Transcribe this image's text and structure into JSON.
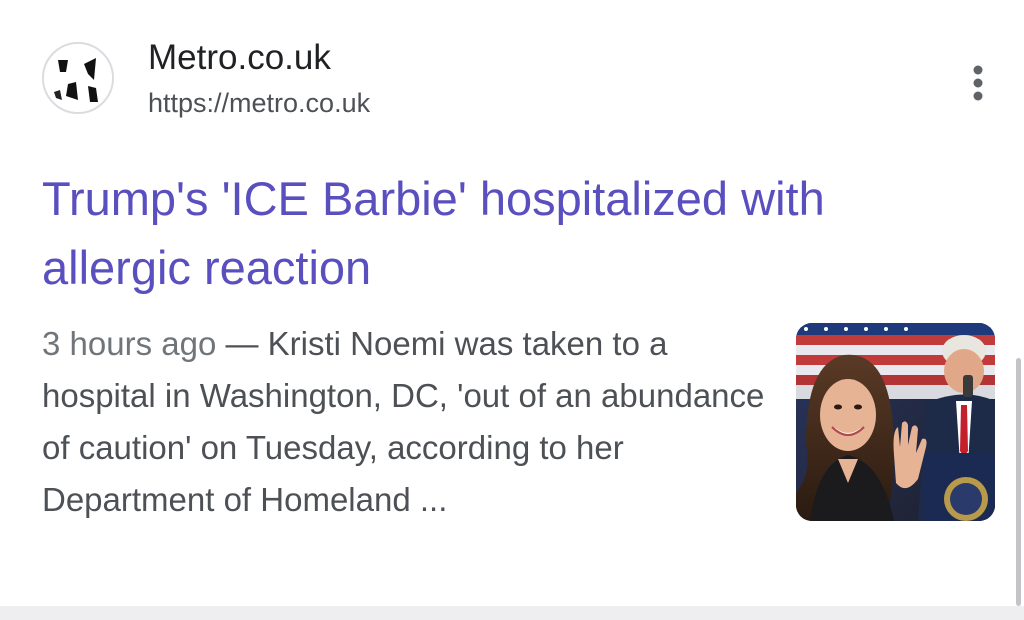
{
  "result": {
    "site_name": "Metro.co.uk",
    "site_url": "https://metro.co.uk",
    "favicon_icon": "metro-logo-icon",
    "more_icon": "more-vert-icon",
    "headline": "Trump's 'ICE Barbie' hospitalized with allergic reaction",
    "snippet_time": "3 hours ago",
    "snippet_separator": " — ",
    "snippet_text": "Kristi Noemi was taken to a hospital in Washington, DC, 'out of an abundance of caution' on Tuesday, according to her Department of Homeland ...",
    "thumbnail_icon": "news-thumbnail-photo"
  },
  "colors": {
    "headline_link": "#5a4fbf",
    "site_text": "#202124",
    "snippet_text": "#4d5156",
    "background": "#ffffff"
  }
}
